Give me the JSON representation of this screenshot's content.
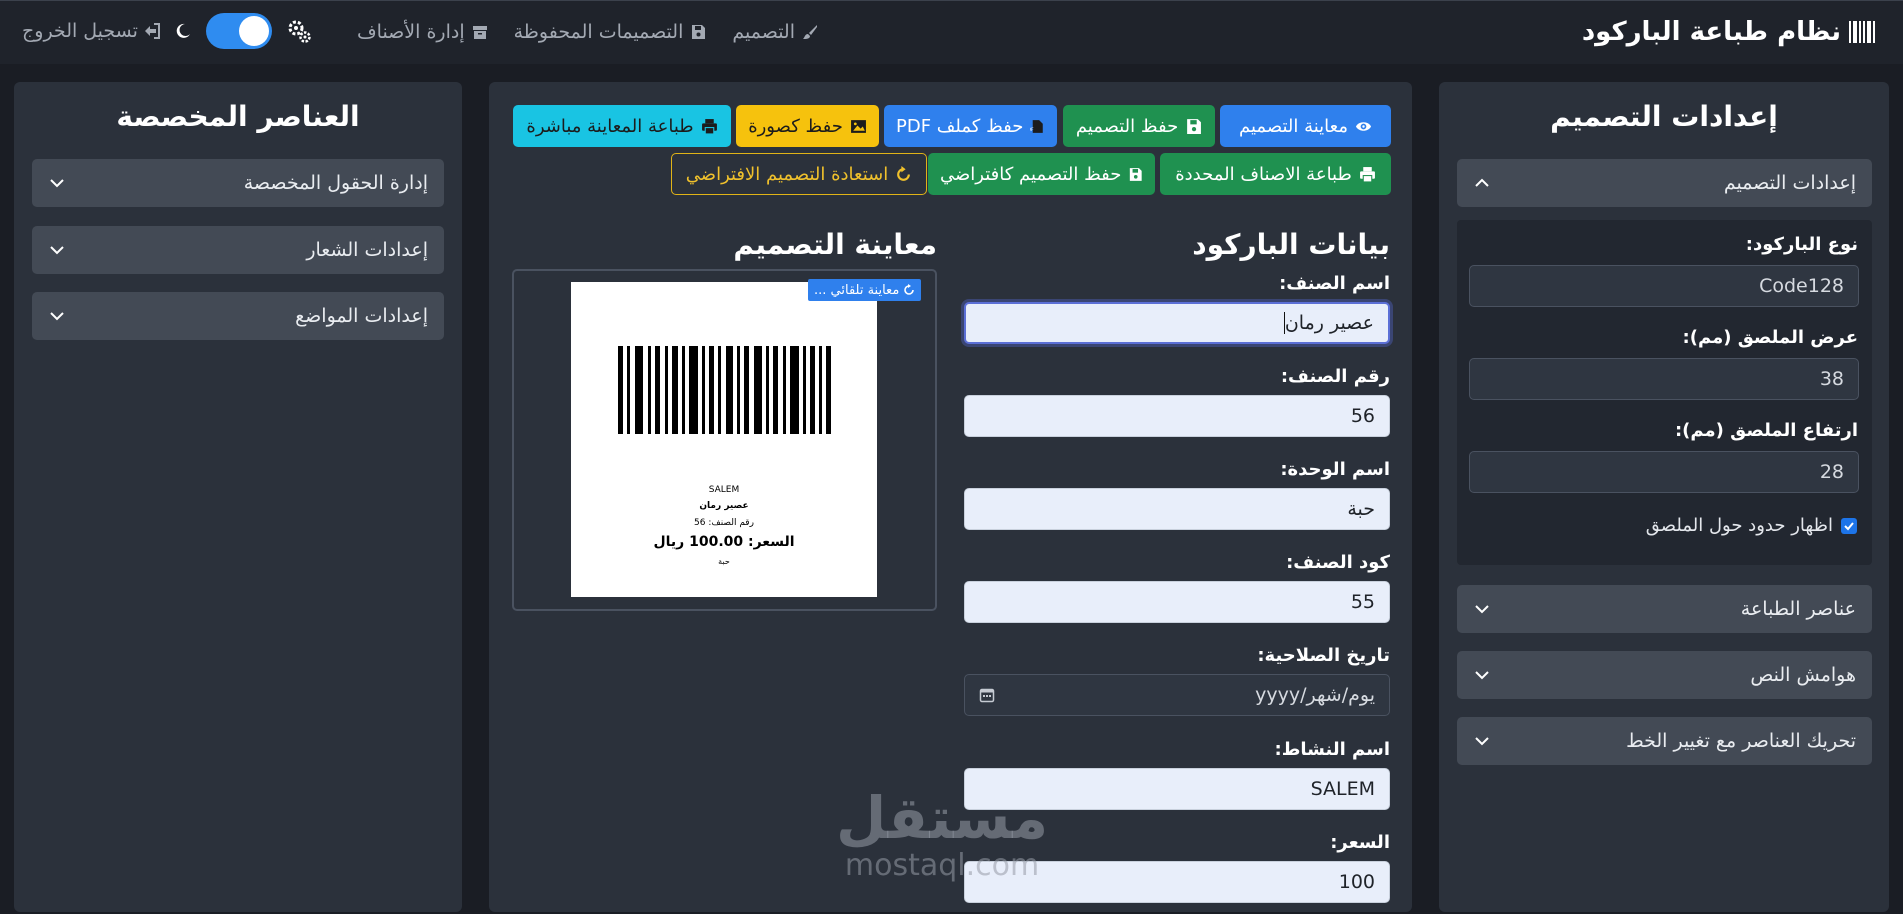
{
  "app": {
    "title": "نظام طباعة الباركود"
  },
  "nav": {
    "design": "التصميم",
    "saved": "التصميمات المحفوظة",
    "items": "إدارة الأصناف",
    "logout": "تسجيل الخروج"
  },
  "right_panel": {
    "title": "إعدادات التصميم",
    "section_design": "إعدادات التصميم",
    "barcode_type_label": "نوع الباركود:",
    "barcode_type_value": "Code128",
    "width_label": "عرض الملصق (مم):",
    "width_value": "38",
    "height_label": "ارتفاع الملصق (مم):",
    "height_value": "28",
    "border_label": "اظهار حدود حول الملصق",
    "border_checked": true,
    "section_print_elements": "عناصر الطباعة",
    "section_margins": "هوامش النص",
    "section_move": "تحريك العناصر مع تغيير الخط"
  },
  "toolbar": {
    "preview": "معاينة التصميم",
    "save": "حفظ التصميم",
    "save_pdf": "حفظ كملف PDF",
    "save_image": "حفظ كصورة",
    "print_preview": "طباعة المعاينة مباشرة",
    "print_selected": "طباعة الاصناف المحددة",
    "save_default": "حفظ التصميم كافتراضي",
    "restore_default": "استعادة التصميم الافتراضي"
  },
  "form": {
    "title": "بيانات الباركود",
    "item_name_label": "اسم الصنف:",
    "item_name_value": "عصير رمان",
    "item_number_label": "رقم الصنف:",
    "item_number_value": "56",
    "unit_label": "اسم الوحدة:",
    "unit_value": "حبة",
    "code_label": "كود الصنف:",
    "code_value": "55",
    "expiry_label": "تاريخ الصلاحية:",
    "expiry_placeholder": "يوم/شهر/yyyy",
    "business_label": "اسم النشاط:",
    "business_value": "SALEM",
    "price_label": "السعر:",
    "price_value": "100"
  },
  "preview": {
    "title": "معاينة التصميم",
    "auto_badge": "معاينة تلقائي ...",
    "business": "SALEM",
    "item_name": "عصير رمان",
    "item_number_line": "رقم الصنف: 56",
    "price_line": "السعر: 100.00 ريال",
    "unit": "حبة"
  },
  "left_panel": {
    "title": "العناصر المخصصة",
    "custom_fields": "إدارة الحقول المخصصة",
    "logo": "إعدادات الشعار",
    "positions": "إعدادات المواضع"
  },
  "watermark": {
    "ar": "مستقل",
    "en": "mostaql.com"
  },
  "colors": {
    "accent": "#2f80ed",
    "success": "#1f9150",
    "warning": "#f6c20d",
    "info": "#19c4e3"
  }
}
